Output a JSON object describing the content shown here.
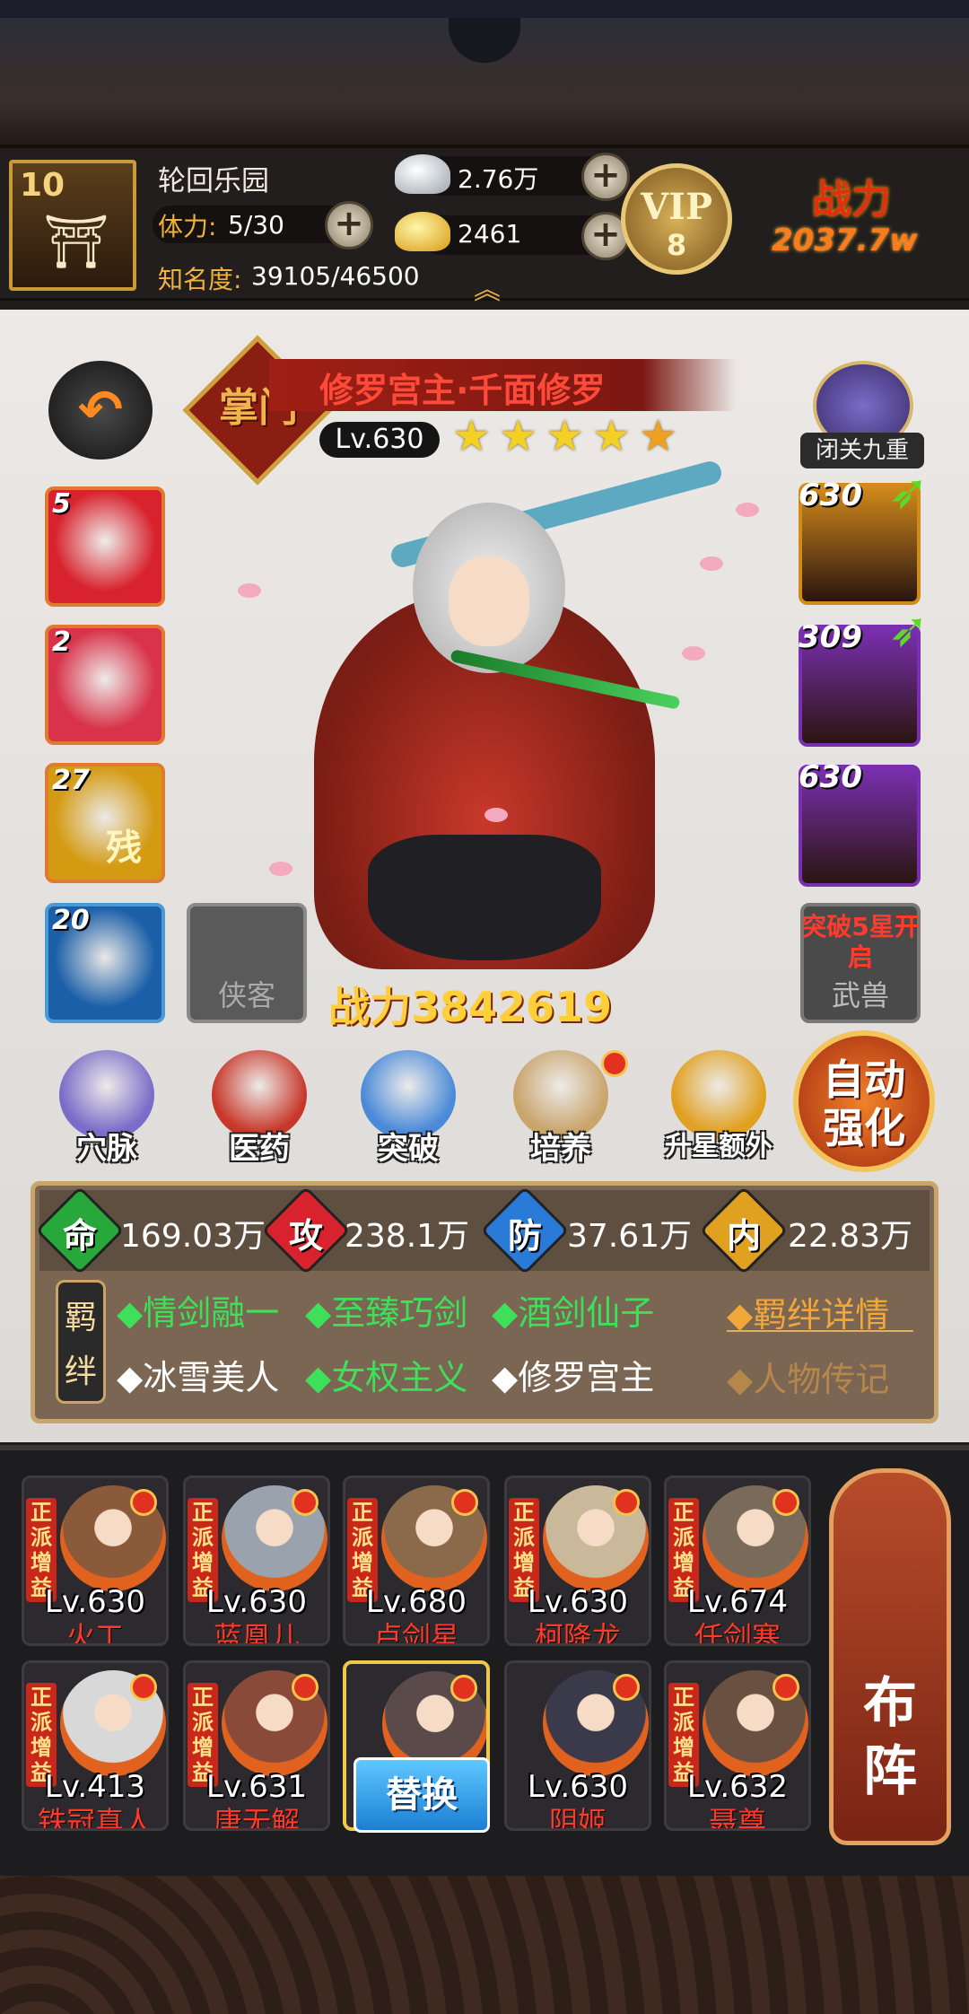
{
  "player": {
    "level": "10",
    "name": "轮回乐园",
    "stamina_label": "体力:",
    "stamina_value": "5/30",
    "fame_label": "知名度:",
    "fame_value": "39105/46500",
    "silver": "2.76万",
    "gold": "2461",
    "vip_label": "VIP",
    "vip_level": "8",
    "power_label": "战力",
    "power_value": "2037.7w"
  },
  "hero": {
    "sect": "掌门",
    "name": "修罗宫主·千面修罗",
    "level": "Lv.630",
    "stars": 5,
    "combat_power": "战力3842619"
  },
  "skills": [
    {
      "num": "5",
      "color": "#d8232e"
    },
    {
      "num": "2",
      "color": "#d8334a"
    },
    {
      "num": "27",
      "color": "#d49a12",
      "glyph": "残"
    },
    {
      "num": "20",
      "color": "#1a5fa8"
    }
  ],
  "xiake_slot": "侠客",
  "retreat_label": "闭关九重",
  "equipment": [
    {
      "num": "630",
      "color": "#d28a1a"
    },
    {
      "num": "309",
      "color": "#7a2fb0"
    },
    {
      "num": "630",
      "color": "#7a2fb0"
    }
  ],
  "beast": {
    "notice": "突破5星开启",
    "label": "武兽"
  },
  "functions": [
    {
      "label": "穴脉",
      "color": "#7a6cc8"
    },
    {
      "label": "医药",
      "color": "#c8382a"
    },
    {
      "label": "突破",
      "color": "#4a8ad8"
    },
    {
      "label": "培养",
      "color": "#c9a46b"
    },
    {
      "label": "升星额外",
      "color": "#e0a020"
    }
  ],
  "auto_enhance": {
    "line1": "自动",
    "line2": "强化"
  },
  "stats": [
    {
      "char": "命",
      "value": "169.03万",
      "color": "#28a83a"
    },
    {
      "char": "攻",
      "value": "238.1万",
      "color": "#d8232e"
    },
    {
      "char": "防",
      "value": "37.61万",
      "color": "#2a7ad8"
    },
    {
      "char": "内",
      "value": "22.83万",
      "color": "#e0a020"
    }
  ],
  "bond_label": "羁绊",
  "bonds": [
    {
      "text": "◆情剑融一",
      "active": true
    },
    {
      "text": "◆至臻巧剑",
      "active": true
    },
    {
      "text": "◆酒剑仙子",
      "active": true
    },
    {
      "text": "◆冰雪美人",
      "active": false
    },
    {
      "text": "◆女权主义",
      "active": true
    },
    {
      "text": "◆修罗宫主",
      "active": false
    }
  ],
  "bond_details": "◆羁绊详情",
  "biography": "◆人物传记",
  "lineup": [
    {
      "tag": "正派增益",
      "level": "Lv.630",
      "name": "火工",
      "color": "#8a5a3a"
    },
    {
      "tag": "正派增益",
      "level": "Lv.630",
      "name": "蓝凰儿",
      "color": "#9aa3ad"
    },
    {
      "tag": "正派增益",
      "level": "Lv.680",
      "name": "卢剑星",
      "color": "#8a6a4a"
    },
    {
      "tag": "正派增益",
      "level": "Lv.630",
      "name": "柯降龙",
      "color": "#c9b89a"
    },
    {
      "tag": "正派增益",
      "level": "Lv.674",
      "name": "任剑寒",
      "color": "#7a6a5a"
    },
    {
      "tag": "正派增益",
      "level": "Lv.413",
      "name": "铁冠真人",
      "color": "#d8d8d8"
    },
    {
      "tag": "正派增益",
      "level": "Lv.631",
      "name": "唐无解",
      "color": "#8a4a3a"
    },
    {
      "tag": "",
      "level": "",
      "name": "",
      "color": "#5a4a4a"
    },
    {
      "tag": "",
      "level": "Lv.630",
      "name": "阴姬",
      "color": "#3a3a4a"
    },
    {
      "tag": "正派增益",
      "level": "Lv.632",
      "name": "聂尊",
      "color": "#6a5040"
    }
  ],
  "replace_label": "替换",
  "formation_label": "布阵"
}
